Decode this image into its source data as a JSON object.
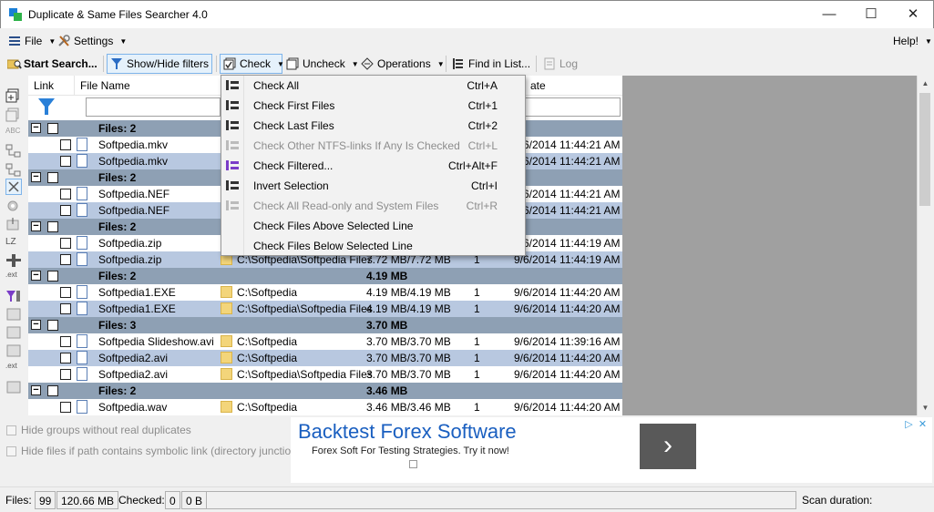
{
  "window": {
    "title": "Duplicate & Same Files Searcher 4.0",
    "minimize": "—",
    "maximize": "☐",
    "close": "✕"
  },
  "menu": {
    "file": "File",
    "settings": "Settings",
    "help": "Help!"
  },
  "toolbar": {
    "start_search": "Start Search...",
    "show_hide_filters": "Show/Hide filters",
    "check": "Check",
    "uncheck": "Uncheck",
    "operations": "Operations",
    "find_in_list": "Find in List...",
    "log": "Log"
  },
  "columns": {
    "link": "Link",
    "file_name": "File Name",
    "date": "ate"
  },
  "rows": [
    {
      "type": "group",
      "label": "Files: 2",
      "size": ""
    },
    {
      "type": "file",
      "name": "Softpedia.mkv",
      "path": "",
      "size": "",
      "links": "",
      "date": "9/6/2014 11:44:21 AM",
      "sel": false
    },
    {
      "type": "file",
      "name": "Softpedia.mkv",
      "path": "",
      "size": "",
      "links": "",
      "date": "9/6/2014 11:44:21 AM",
      "sel": true
    },
    {
      "type": "group",
      "label": "Files: 2",
      "size": ""
    },
    {
      "type": "file",
      "name": "Softpedia.NEF",
      "path": "",
      "size": "",
      "links": "",
      "date": "9/6/2014 11:44:21 AM",
      "sel": false
    },
    {
      "type": "file",
      "name": "Softpedia.NEF",
      "path": "",
      "size": "",
      "links": "",
      "date": "9/6/2014 11:44:21 AM",
      "sel": true
    },
    {
      "type": "group",
      "label": "Files: 2",
      "size": ""
    },
    {
      "type": "file",
      "name": "Softpedia.zip",
      "path": "",
      "size": "",
      "links": "",
      "date": "9/6/2014 11:44:19 AM",
      "sel": false
    },
    {
      "type": "file",
      "name": "Softpedia.zip",
      "path": "C:\\Softpedia\\Softpedia Files",
      "size": "7.72 MB/7.72 MB",
      "links": "1",
      "date": "9/6/2014 11:44:19 AM",
      "sel": true
    },
    {
      "type": "group",
      "label": "Files: 2",
      "size": "4.19 MB"
    },
    {
      "type": "file",
      "name": "Softpedia1.EXE",
      "path": "C:\\Softpedia",
      "size": "4.19 MB/4.19 MB",
      "links": "1",
      "date": "9/6/2014 11:44:20 AM",
      "sel": false
    },
    {
      "type": "file",
      "name": "Softpedia1.EXE",
      "path": "C:\\Softpedia\\Softpedia Files",
      "size": "4.19 MB/4.19 MB",
      "links": "1",
      "date": "9/6/2014 11:44:20 AM",
      "sel": true
    },
    {
      "type": "group",
      "label": "Files: 3",
      "size": "3.70 MB"
    },
    {
      "type": "file",
      "name": "Softpedia Slideshow.avi",
      "path": "C:\\Softpedia",
      "size": "3.70 MB/3.70 MB",
      "links": "1",
      "date": "9/6/2014 11:39:16 AM",
      "sel": false
    },
    {
      "type": "file",
      "name": "Softpedia2.avi",
      "path": "C:\\Softpedia",
      "size": "3.70 MB/3.70 MB",
      "links": "1",
      "date": "9/6/2014 11:44:20 AM",
      "sel": true
    },
    {
      "type": "file",
      "name": "Softpedia2.avi",
      "path": "C:\\Softpedia\\Softpedia Files",
      "size": "3.70 MB/3.70 MB",
      "links": "1",
      "date": "9/6/2014 11:44:20 AM",
      "sel": false
    },
    {
      "type": "group",
      "label": "Files: 2",
      "size": "3.46 MB"
    },
    {
      "type": "file",
      "name": "Softpedia.wav",
      "path": "C:\\Softpedia",
      "size": "3.46 MB/3.46 MB",
      "links": "1",
      "date": "9/6/2014 11:44:20 AM",
      "sel": false
    }
  ],
  "check_menu": [
    {
      "label": "Check All",
      "shortcut": "Ctrl+A",
      "disabled": false
    },
    {
      "label": "Check First Files",
      "shortcut": "Ctrl+1",
      "disabled": false
    },
    {
      "label": "Check Last Files",
      "shortcut": "Ctrl+2",
      "disabled": false
    },
    {
      "label": "Check Other NTFS-links If Any Is Checked",
      "shortcut": "Ctrl+L",
      "disabled": true
    },
    {
      "label": "Check Filtered...",
      "shortcut": "Ctrl+Alt+F",
      "disabled": false
    },
    {
      "label": "Invert Selection",
      "shortcut": "Ctrl+I",
      "disabled": false
    },
    {
      "label": "Check All Read-only and System Files",
      "shortcut": "Ctrl+R",
      "disabled": true
    },
    {
      "label": "Check Files Above Selected Line",
      "shortcut": "",
      "disabled": false
    },
    {
      "label": "Check Files Below Selected Line",
      "shortcut": "",
      "disabled": false
    }
  ],
  "options": {
    "hide_groups": "Hide groups without real duplicates",
    "hide_symlinks": "Hide files if path contains symbolic link (directory junction)"
  },
  "ad": {
    "title": "Backtest Forex Software",
    "subtitle": "Forex Soft For Testing Strategies. Try it now!",
    "go": "›",
    "adchoices": "▷",
    "close": "✕"
  },
  "status": {
    "files_label": "Files:",
    "files_count": "99",
    "files_size": "120.66 MB",
    "checked_label": "Checked:",
    "checked_count": "0",
    "checked_size": "0 B",
    "scan_duration": "Scan duration:"
  },
  "colors": {
    "group_row": "#8ea0b4",
    "selected_row": "#b8c8e0",
    "ad_title": "#1a5fc0"
  }
}
